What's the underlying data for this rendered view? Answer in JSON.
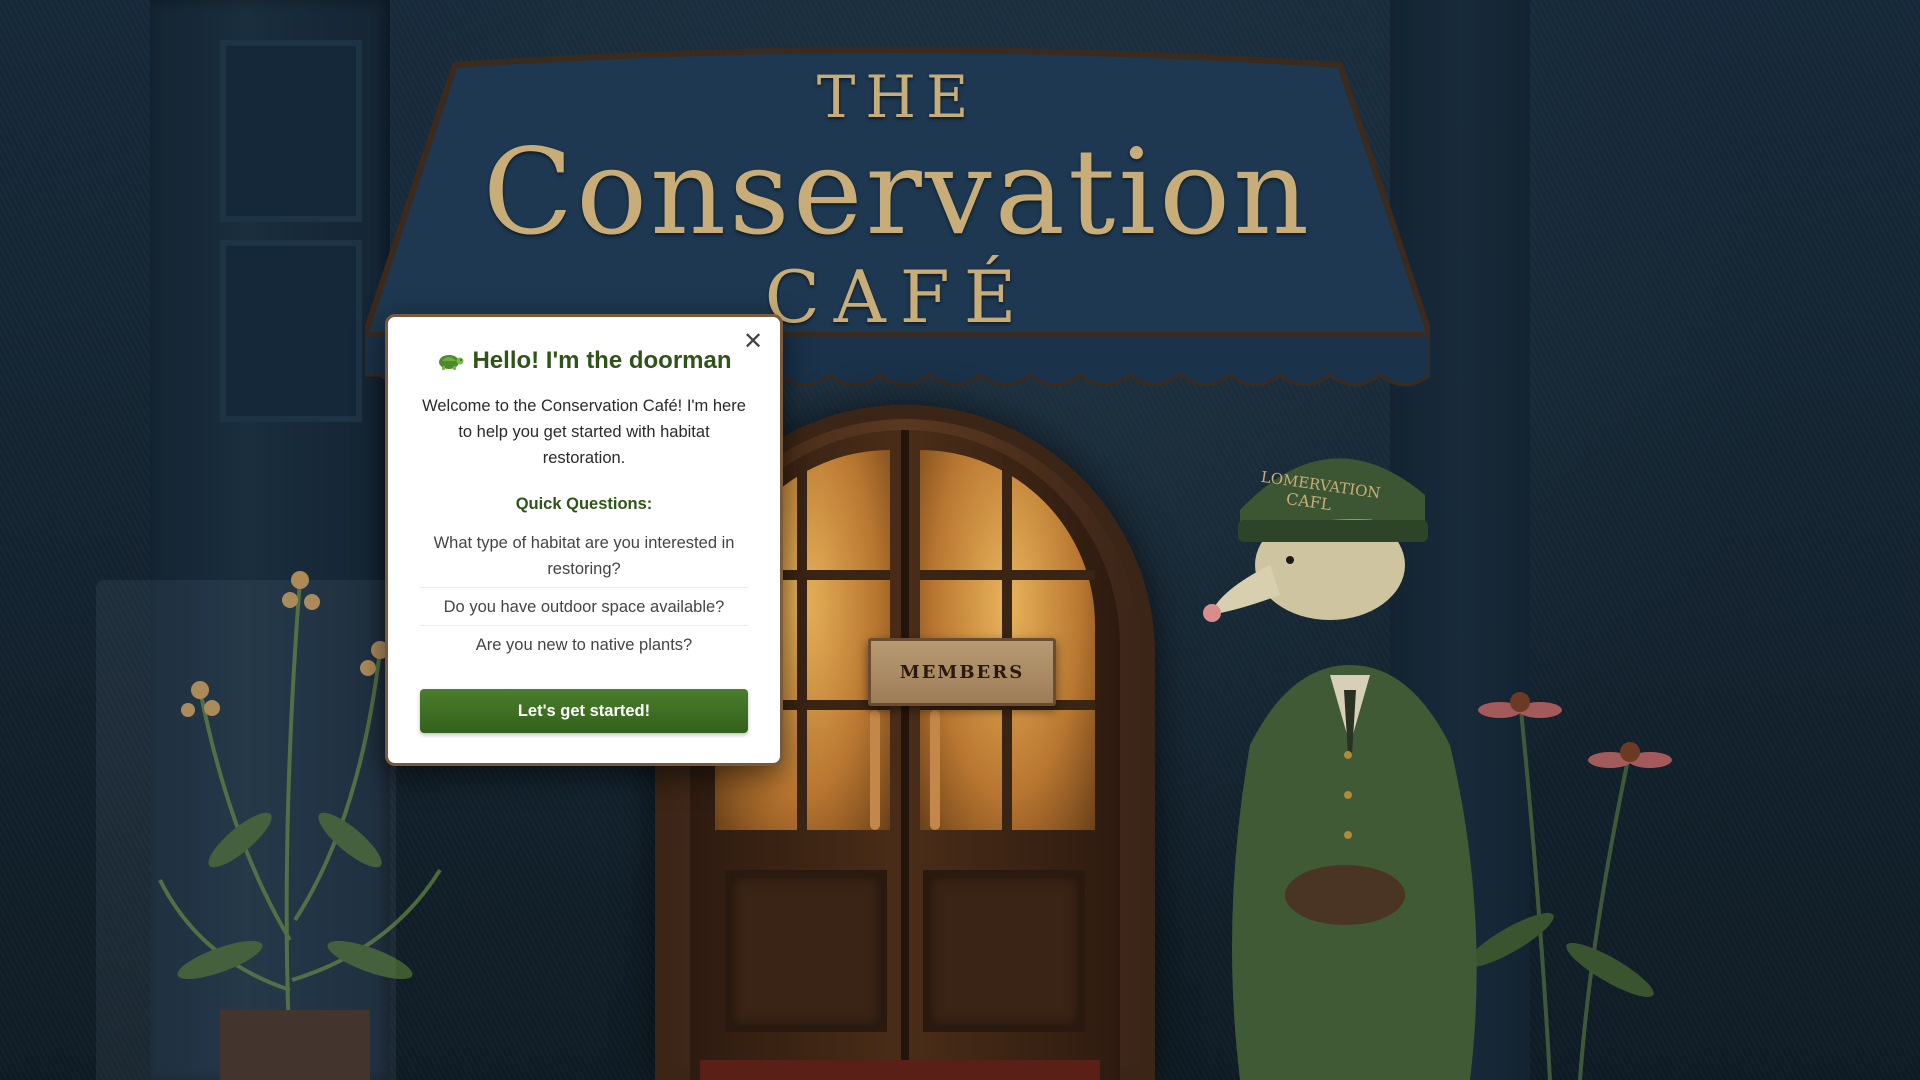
{
  "scene": {
    "sign_line1": "THE",
    "sign_line2": "Conservation",
    "sign_line3": "CAFÉ",
    "members_plaque": "MEMBERS",
    "doorman_hat_line1": "LOMERVATION",
    "doorman_hat_line2": "CAFL"
  },
  "modal": {
    "title_icon": "turtle-icon",
    "title": "Hello! I'm the doorman",
    "intro": "Welcome to the Conservation Café! I'm here to help you get started with habitat restoration.",
    "quick_heading": "Quick Questions:",
    "questions": [
      "What type of habitat are you interested in restoring?",
      "Do you have outdoor space available?",
      "Are you new to native plants?"
    ],
    "start_label": "Let's get started!",
    "close_icon": "close-icon"
  },
  "colors": {
    "accent_green": "#2e5517",
    "button_green": "#3f7024",
    "modal_border": "#7a5a3a",
    "sign_gold": "#c8ad78",
    "background": "#13232f"
  }
}
